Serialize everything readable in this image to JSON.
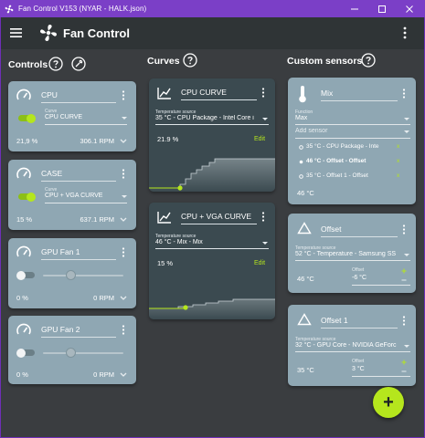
{
  "window": {
    "title": "Fan Control V153 (NYAR - HALK.json)",
    "min_glyph": "—",
    "max_glyph": "☐",
    "close_glyph": "✕"
  },
  "appbar": {
    "title": "Fan Control"
  },
  "sections": {
    "controls": "Controls",
    "curves": "Curves",
    "custom_sensors": "Custom sensors"
  },
  "controls": [
    {
      "name": "CPU",
      "curve_label": "Curve",
      "curve": "CPU CURVE",
      "percent": "21,9 %",
      "rpm": "306.1 RPM",
      "enabled": true
    },
    {
      "name": "CASE",
      "curve_label": "Curve",
      "curve": "CPU + VGA CURVE",
      "percent": "15 %",
      "rpm": "637.1 RPM",
      "enabled": true
    },
    {
      "name": "GPU Fan 1",
      "percent": "0 %",
      "rpm": "0 RPM",
      "enabled": false,
      "level": 0.3
    },
    {
      "name": "GPU Fan 2",
      "percent": "0 %",
      "rpm": "0 RPM",
      "enabled": false,
      "level": 0.3
    }
  ],
  "curves": [
    {
      "name": "CPU CURVE",
      "source_label": "Temperature source",
      "source": "35 °C - CPU Package - Intel Core i",
      "percent": "21.9 %",
      "edit": "Edit"
    },
    {
      "name": "CPU + VGA CURVE",
      "source_label": "Temperature source",
      "source": "46 °C - Mix - Mix",
      "percent": "15 %",
      "edit": "Edit"
    }
  ],
  "sensors": {
    "mix": {
      "name": "Mix",
      "function_label": "Function",
      "function": "Max",
      "add_sensor": "Add sensor",
      "items": [
        {
          "text": "35 °C - CPU Package - Inte",
          "bold": false
        },
        {
          "text": "46 °C - Offset - Offset",
          "bold": true
        },
        {
          "text": "35 °C - Offset 1 - Offset",
          "bold": false
        }
      ],
      "x": "x",
      "value": "46 °C"
    },
    "offset": {
      "name": "Offset",
      "source_label": "Temperature source",
      "source": "52 °C - Temperature - Samsung SS",
      "value": "46 °C",
      "offset_label": "Offset",
      "offset": "-6 °C"
    },
    "offset1": {
      "name": "Offset 1",
      "source_label": "Temperature source",
      "source": "32 °C - GPU Core - NVIDIA GeForc",
      "value": "35 °C",
      "offset_label": "Offset",
      "offset": "3 °C"
    }
  },
  "fab": {
    "label": "+"
  },
  "colors": {
    "accent": "#b5e61d",
    "card": "#8fa7b3",
    "card_dark": "#3b4a50",
    "background": "#3a3d40",
    "titlebar": "#7b3fc7"
  }
}
